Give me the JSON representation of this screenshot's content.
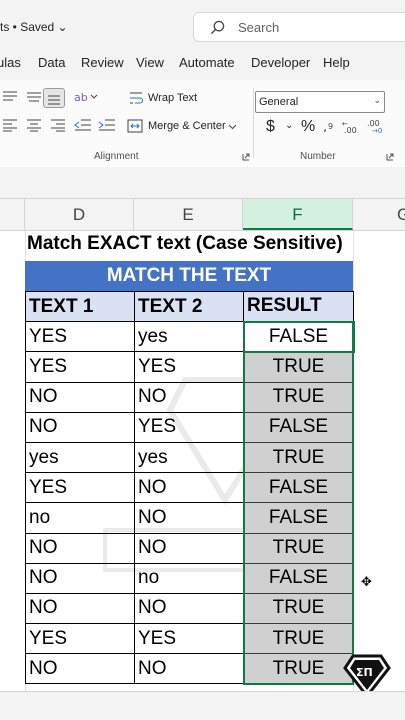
{
  "titlebar": {
    "title": "rts • Saved ⌄",
    "search_placeholder": "Search"
  },
  "menu": {
    "items": [
      "ulas",
      "Data",
      "Review",
      "View",
      "Automate",
      "Developer",
      "Help"
    ]
  },
  "ribbon": {
    "wrap_text": "Wrap Text",
    "merge_center": "Merge & Center",
    "alignment_label": "Alignment",
    "number_label": "Number",
    "number_format": "General",
    "currency_symbol": "$",
    "percent_symbol": "%"
  },
  "columns": [
    "D",
    "E",
    "F",
    "G"
  ],
  "selected_column": "F",
  "sheet": {
    "heading": "Match EXACT text (Case Sensitive)",
    "banner": "MATCH THE TEXT",
    "headers": [
      "TEXT 1",
      "TEXT 2",
      "RESULT"
    ],
    "rows": [
      [
        "YES",
        "yes",
        "FALSE"
      ],
      [
        "YES",
        "YES",
        "TRUE"
      ],
      [
        "NO",
        "NO",
        "TRUE"
      ],
      [
        "NO",
        "YES",
        "FALSE"
      ],
      [
        "yes",
        "yes",
        "TRUE"
      ],
      [
        "YES",
        "NO",
        "FALSE"
      ],
      [
        "no",
        "NO",
        "FALSE"
      ],
      [
        "NO",
        "NO",
        "TRUE"
      ],
      [
        "NO",
        "no",
        "FALSE"
      ],
      [
        "NO",
        "NO",
        "TRUE"
      ],
      [
        "YES",
        "YES",
        "TRUE"
      ],
      [
        "NO",
        "NO",
        "TRUE"
      ]
    ]
  },
  "colors": {
    "banner": "#4472c4",
    "header_fill": "#d9e1f2",
    "result_fill": "#d0d0d0",
    "selection": "#107c41"
  },
  "icons": [
    "search-icon",
    "align-top-icon",
    "align-middle-icon",
    "align-bottom-icon",
    "orientation-icon",
    "align-left-icon",
    "align-center-icon",
    "align-right-icon",
    "decrease-indent-icon",
    "increase-indent-icon",
    "wrap-text-icon",
    "merge-center-icon",
    "increase-decimal-icon",
    "decrease-decimal-icon",
    "dialog-launcher-icon",
    "cell-cursor-icon",
    "brand-logo-icon"
  ]
}
